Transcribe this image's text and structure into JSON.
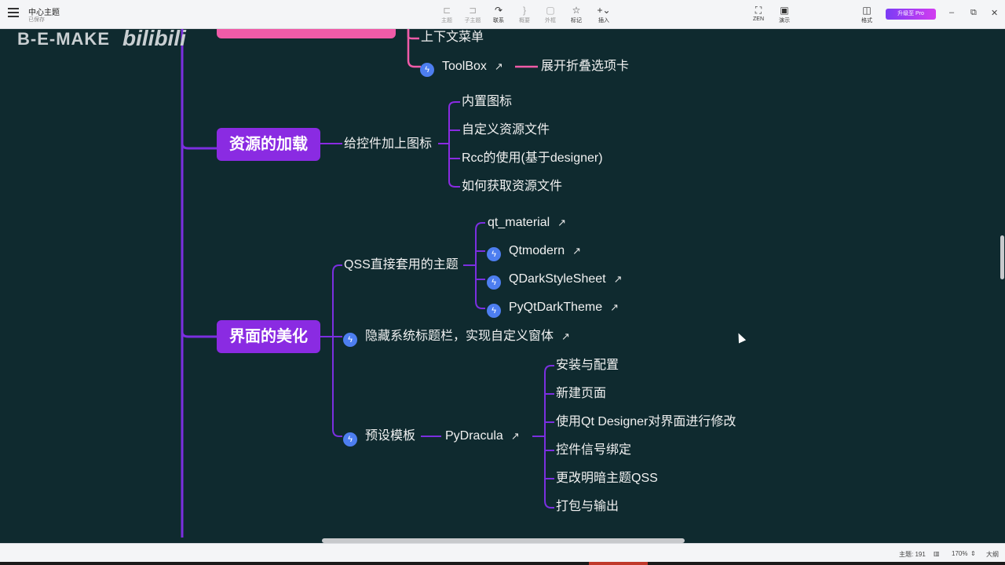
{
  "app": {
    "doc_title": "中心主题",
    "doc_subtitle": "已保存"
  },
  "toolbar": {
    "tools": [
      {
        "label": "主题",
        "icon": "topic-icon",
        "active": false
      },
      {
        "label": "子主题",
        "icon": "subtopic-icon",
        "active": false
      },
      {
        "label": "联系",
        "icon": "relationship-icon",
        "active": true
      },
      {
        "label": "概要",
        "icon": "summary-icon",
        "active": false
      },
      {
        "label": "外框",
        "icon": "boundary-icon",
        "active": false
      },
      {
        "label": "标记",
        "icon": "marker-icon",
        "active": true
      },
      {
        "label": "插入",
        "icon": "insert-icon",
        "active": true
      }
    ],
    "zen_label": "ZEN",
    "present_label": "演示",
    "format_label": "格式",
    "pro_label": "升级至 Pro"
  },
  "watermark": {
    "text": "B-E-MAKE",
    "logo": "bilibili"
  },
  "mindmap": {
    "branch_top": {
      "children": [
        {
          "label": "上下文菜单",
          "bolt": false,
          "link": false
        },
        {
          "label": "ToolBox",
          "bolt": true,
          "link": true,
          "note": "展开折叠选项卡"
        }
      ]
    },
    "branch_resources": {
      "label": "资源的加载",
      "child": "给控件加上图标",
      "children": [
        "内置图标",
        "自定义资源文件",
        "Rcc的使用(基于designer)",
        "如何获取资源文件"
      ]
    },
    "branch_ui": {
      "label": "界面的美化",
      "qss": {
        "label": "QSS直接套用的主题",
        "children": [
          {
            "label": "qt_material",
            "bolt": false
          },
          {
            "label": "Qtmodern",
            "bolt": true
          },
          {
            "label": "QDarkStyleSheet",
            "bolt": true
          },
          {
            "label": "PyQtDarkTheme",
            "bolt": true
          }
        ]
      },
      "hide_title": "隐藏系统标题栏，实现自定义窗体",
      "preset": {
        "label": "预设模板",
        "child": "PyDracula",
        "children": [
          "安装与配置",
          "新建页面",
          "使用Qt Designer对界面进行修改",
          "控件信号绑定",
          "更改明暗主题QSS",
          "打包与输出"
        ]
      }
    }
  },
  "statusbar": {
    "topics_label": "主题: 191",
    "zoom": "170%",
    "outline_label": "大纲"
  }
}
